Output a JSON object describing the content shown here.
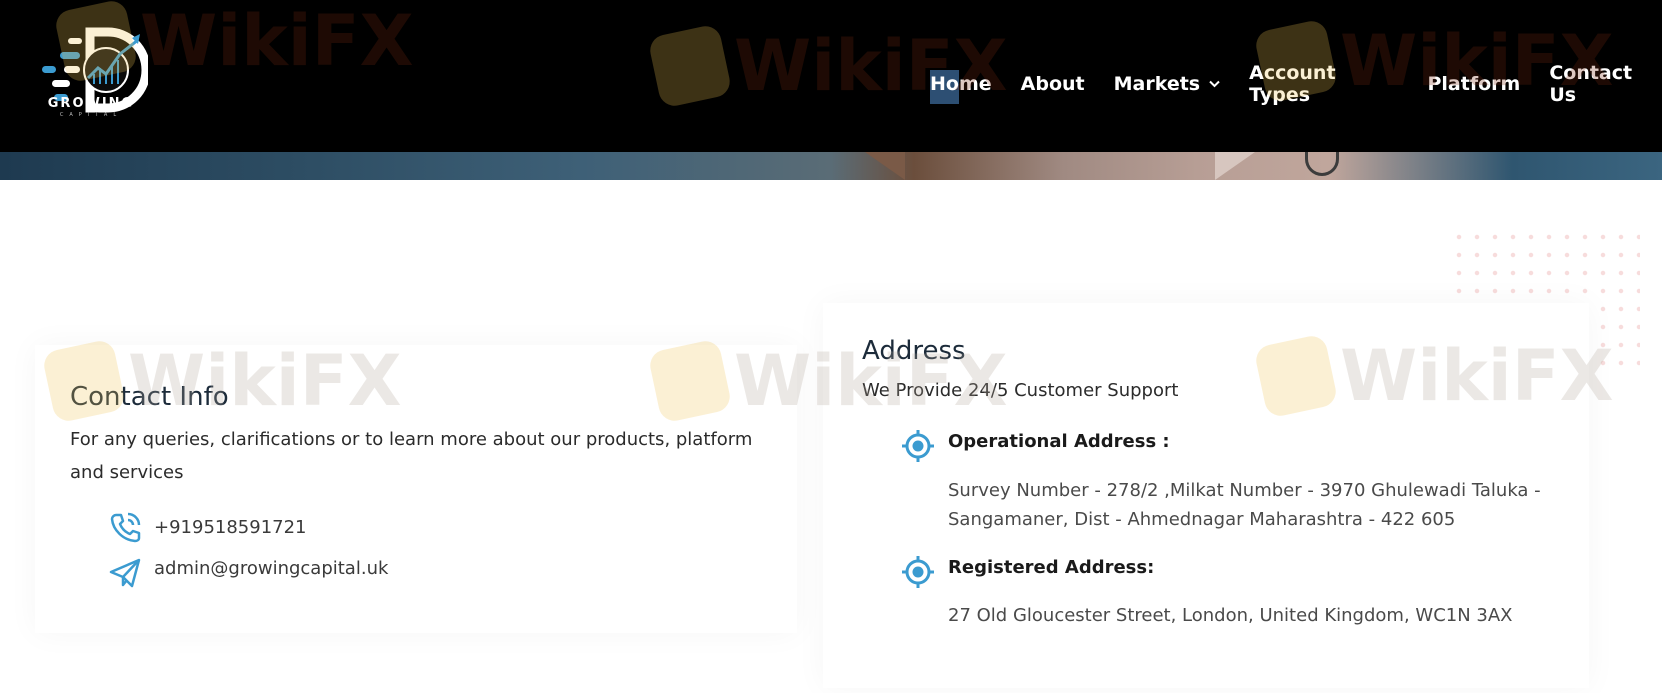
{
  "brand": {
    "name": "GROWING",
    "subtitle": "CAPITAL"
  },
  "nav": {
    "items": [
      {
        "label": "Home",
        "active": true
      },
      {
        "label": "About"
      },
      {
        "label": "Markets",
        "has_dropdown": true
      },
      {
        "label": "Account Types"
      },
      {
        "label": "Platform"
      },
      {
        "label": "Contact Us"
      }
    ]
  },
  "contact": {
    "title": "Contact Info",
    "description": "For any queries, clarifications or to learn more about our products, platform and services",
    "phone": "+919518591721",
    "email": "admin@growingcapital.uk"
  },
  "address": {
    "title": "Address",
    "support": "We Provide 24/5 Customer Support",
    "operational_label": "Operational Address :",
    "operational_text": "Survey Number - 278/2 ,Milkat Number - 3970 Ghulewadi Taluka - Sangamaner, Dist - Ahmednagar Maharashtra - 422 605",
    "registered_label": "Registered Address:",
    "registered_text": "27 Old Gloucester Street, London, United Kingdom, WC1N 3AX"
  },
  "watermark": {
    "text": "WikiFX"
  },
  "colors": {
    "accent": "#3b9bd0",
    "header_bg": "#000000",
    "nav_highlight": "#2d4f73"
  },
  "icons": {
    "phone": "phone-icon",
    "email": "send-icon",
    "address": "target-icon",
    "chevron": "chevron-down-icon"
  }
}
